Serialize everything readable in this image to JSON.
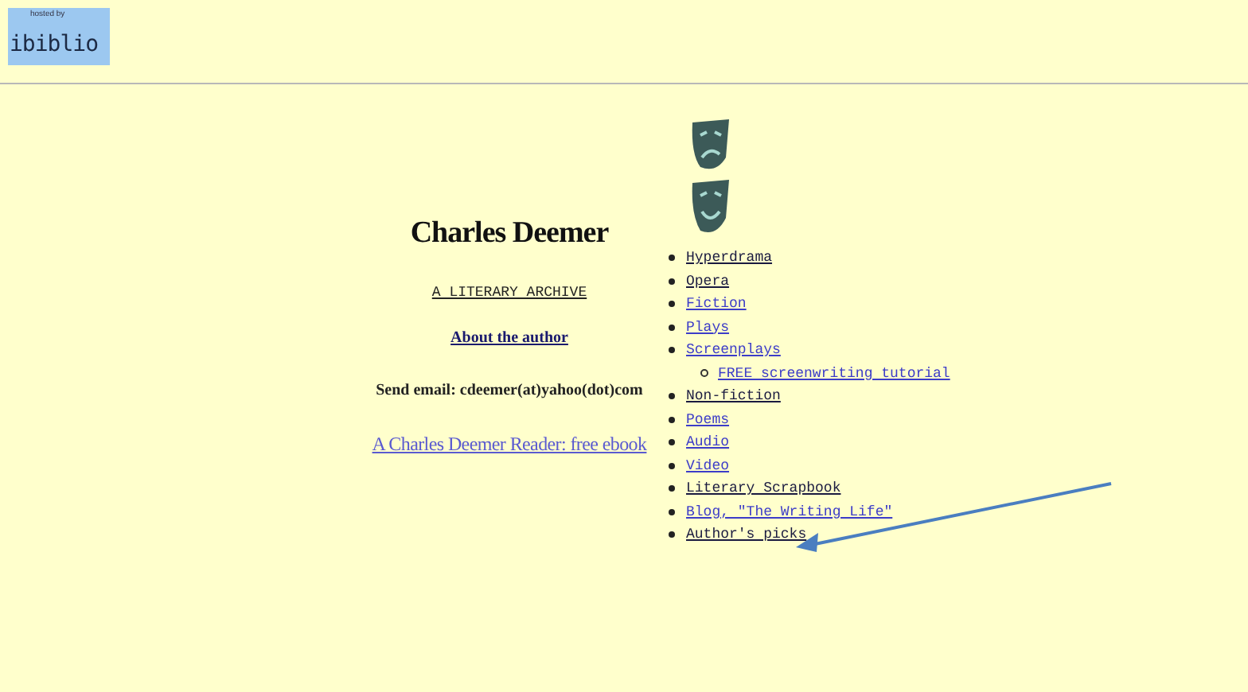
{
  "logo": {
    "caption": "hosted by",
    "wordmark": "ibiblio"
  },
  "author": {
    "name": "Charles Deemer",
    "archive_link": "A LITERARY ARCHIVE",
    "about_link": "About the author",
    "email": "Send email: cdeemer(at)yahoo(dot)com",
    "ebook_link": "A Charles Deemer Reader: free ebook"
  },
  "menu": [
    {
      "label": "Hyperdrama",
      "visited": true
    },
    {
      "label": "Opera",
      "visited": true
    },
    {
      "label": "Fiction",
      "visited": false
    },
    {
      "label": "Plays",
      "visited": false
    },
    {
      "label": "Screenplays",
      "visited": false,
      "children": [
        {
          "label": "FREE screenwriting tutorial",
          "visited": false
        }
      ]
    },
    {
      "label": "Non-fiction",
      "visited": true
    },
    {
      "label": "Poems",
      "visited": false
    },
    {
      "label": "Audio",
      "visited": false
    },
    {
      "label": "Video",
      "visited": false
    },
    {
      "label": "Literary Scrapbook",
      "visited": true
    },
    {
      "label": "Blog, \"The Writing Life\"",
      "visited": false
    },
    {
      "label": "Author's picks",
      "visited": true
    }
  ]
}
